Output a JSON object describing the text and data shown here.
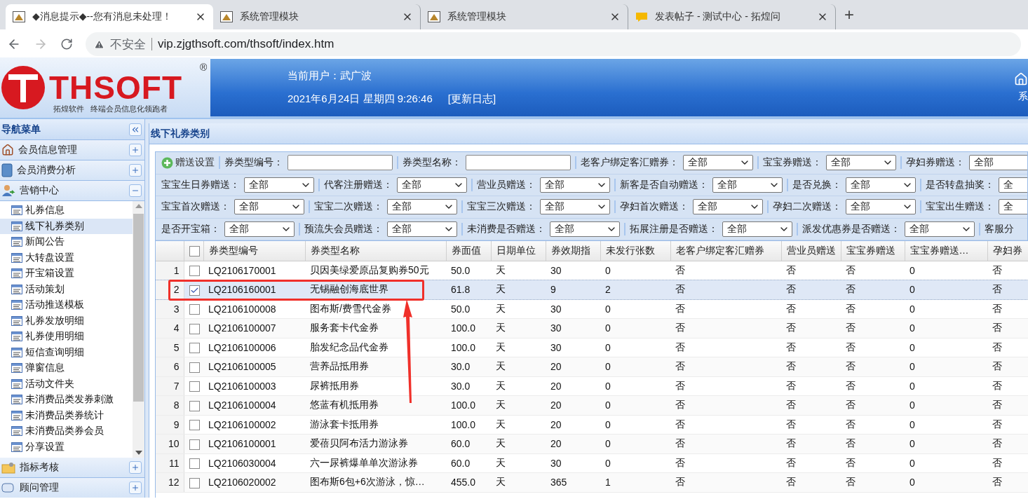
{
  "browser": {
    "tabs": [
      {
        "title": "◆消息提示◆--您有消息未处理！",
        "selected": true,
        "kind": "app"
      },
      {
        "title": "系统管理模块",
        "selected": false,
        "kind": "app"
      },
      {
        "title": "系统管理模块",
        "selected": false,
        "kind": "app"
      },
      {
        "title": "发表帖子 - 测试中心 - 拓煌问",
        "selected": false,
        "kind": "chat"
      }
    ],
    "new_tab": "+",
    "security": "不安全",
    "url": "vip.zjgthsoft.com/thsoft/index.htm"
  },
  "header": {
    "logo": "THSOFT",
    "registered": "®",
    "slogan": "拓煌软件   终端会员信息化领跑者",
    "user_label": "当前用户：",
    "user": "武广波",
    "datetime": "2021年6月24日 星期四 9:26:46",
    "changelog": "[更新日志]",
    "system_button": "系"
  },
  "sidebar": {
    "title": "导航菜单",
    "sections": [
      {
        "label": "会员信息管理",
        "kind": "home",
        "expanded": false
      },
      {
        "label": "会员消费分析",
        "kind": "book",
        "expanded": false
      },
      {
        "label": "营销中心",
        "kind": "person",
        "expanded": true,
        "children": [
          {
            "label": "礼券信息",
            "selected": false
          },
          {
            "label": "线下礼券类别",
            "selected": true
          },
          {
            "label": "新闻公告",
            "selected": false
          },
          {
            "label": "大转盘设置",
            "selected": false
          },
          {
            "label": "开宝箱设置",
            "selected": false
          },
          {
            "label": "活动策划",
            "selected": false
          },
          {
            "label": "活动推送模板",
            "selected": false
          },
          {
            "label": "礼券发放明细",
            "selected": false
          },
          {
            "label": "礼券使用明细",
            "selected": false
          },
          {
            "label": "短信查询明细",
            "selected": false
          },
          {
            "label": "弹窗信息",
            "selected": false
          },
          {
            "label": "活动文件夹",
            "selected": false
          },
          {
            "label": "未消费品类发券刺激",
            "selected": false
          },
          {
            "label": "未消费品类券统计",
            "selected": false
          },
          {
            "label": "未消费品类券会员",
            "selected": false
          },
          {
            "label": "分享设置",
            "selected": false
          }
        ]
      },
      {
        "label": "指标考核",
        "kind": "chart",
        "expanded": false
      },
      {
        "label": "顾问管理",
        "kind": "chat",
        "expanded": false
      }
    ]
  },
  "panel": {
    "title": "线下礼券类别",
    "add_button": "赠送设置",
    "filters": [
      [
        {
          "kind": "text",
          "label": "券类型编号："
        },
        {
          "kind": "text",
          "label": "券类型名称："
        },
        {
          "kind": "select",
          "label": "老客户绑定客汇赠券：",
          "value": "全部"
        },
        {
          "kind": "select",
          "label": "宝宝券赠送：",
          "value": "全部"
        },
        {
          "kind": "edge_select",
          "label": "孕妇券赠送：",
          "value": "全部"
        }
      ],
      [
        {
          "kind": "select",
          "label": "宝宝生日券赠送：",
          "value": "全部"
        },
        {
          "kind": "select",
          "label": "代客注册赠送：",
          "value": "全部"
        },
        {
          "kind": "select",
          "label": "营业员赠送：",
          "value": "全部"
        },
        {
          "kind": "select",
          "label": "新客是否自动赠送：",
          "value": "全部"
        },
        {
          "kind": "select",
          "label": "是否兑换：",
          "value": "全部"
        },
        {
          "kind": "edge_select",
          "label": "是否转盘抽奖：",
          "value": "全"
        }
      ],
      [
        {
          "kind": "select",
          "label": "宝宝首次赠送：",
          "value": "全部"
        },
        {
          "kind": "select",
          "label": "宝宝二次赠送：",
          "value": "全部"
        },
        {
          "kind": "select",
          "label": "宝宝三次赠送：",
          "value": "全部"
        },
        {
          "kind": "select",
          "label": "孕妇首次赠送：",
          "value": "全部"
        },
        {
          "kind": "select",
          "label": "孕妇二次赠送：",
          "value": "全部"
        },
        {
          "kind": "edge_select",
          "label": "宝宝出生赠送：",
          "value": "全"
        }
      ],
      [
        {
          "kind": "select",
          "label": "是否开宝箱：",
          "value": "全部"
        },
        {
          "kind": "select",
          "label": "预流失会员赠送：",
          "value": "全部"
        },
        {
          "kind": "select",
          "label": "未消费是否赠送：",
          "value": "全部"
        },
        {
          "kind": "select",
          "label": "拓展注册是否赠送：",
          "value": "全部"
        },
        {
          "kind": "select",
          "label": "派发优惠券是否赠送：",
          "value": "全部"
        },
        {
          "kind": "label",
          "label": "客服分"
        }
      ]
    ]
  },
  "table": {
    "all_checked": false,
    "columns": [
      "券类型编号",
      "券类型名称",
      "券面值",
      "日期单位",
      "券效期指",
      "未发行张数",
      "老客户绑定客汇赠券",
      "营业员赠送",
      "宝宝券赠送",
      "宝宝券赠送…",
      "孕妇券"
    ],
    "rows": [
      {
        "no": "1",
        "checked": false,
        "selected": false,
        "annotated": false,
        "cells": [
          "LQ2106170001",
          "贝因美绿爱原品复购券50元",
          "50.0",
          "天",
          "30",
          "0",
          "否",
          "否",
          "否",
          "0",
          "否"
        ]
      },
      {
        "no": "2",
        "checked": true,
        "selected": true,
        "annotated": true,
        "cells": [
          "LQ2106160001",
          "无锡融创海底世界",
          "61.8",
          "天",
          "9",
          "2",
          "否",
          "否",
          "否",
          "0",
          "否"
        ]
      },
      {
        "no": "3",
        "checked": false,
        "selected": false,
        "annotated": false,
        "cells": [
          "LQ2106100008",
          "图布斯/费雪代金券",
          "50.0",
          "天",
          "30",
          "0",
          "否",
          "否",
          "否",
          "0",
          "否"
        ]
      },
      {
        "no": "4",
        "checked": false,
        "selected": false,
        "annotated": false,
        "cells": [
          "LQ2106100007",
          "服务套卡代金券",
          "100.0",
          "天",
          "30",
          "0",
          "否",
          "否",
          "否",
          "0",
          "否"
        ]
      },
      {
        "no": "5",
        "checked": false,
        "selected": false,
        "annotated": false,
        "cells": [
          "LQ2106100006",
          "胎发纪念品代金券",
          "100.0",
          "天",
          "30",
          "0",
          "否",
          "否",
          "否",
          "0",
          "否"
        ]
      },
      {
        "no": "6",
        "checked": false,
        "selected": false,
        "annotated": false,
        "cells": [
          "LQ2106100005",
          "营养品抵用券",
          "30.0",
          "天",
          "20",
          "0",
          "否",
          "否",
          "否",
          "0",
          "否"
        ]
      },
      {
        "no": "7",
        "checked": false,
        "selected": false,
        "annotated": false,
        "cells": [
          "LQ2106100003",
          "尿裤抵用券",
          "30.0",
          "天",
          "20",
          "0",
          "否",
          "否",
          "否",
          "0",
          "否"
        ]
      },
      {
        "no": "8",
        "checked": false,
        "selected": false,
        "annotated": false,
        "cells": [
          "LQ2106100004",
          "悠蓝有机抵用券",
          "100.0",
          "天",
          "20",
          "0",
          "否",
          "否",
          "否",
          "0",
          "否"
        ]
      },
      {
        "no": "9",
        "checked": false,
        "selected": false,
        "annotated": false,
        "cells": [
          "LQ2106100002",
          "游泳套卡抵用券",
          "100.0",
          "天",
          "20",
          "0",
          "否",
          "否",
          "否",
          "0",
          "否"
        ]
      },
      {
        "no": "10",
        "checked": false,
        "selected": false,
        "annotated": false,
        "cells": [
          "LQ2106100001",
          "爱蓓贝阿布活力游泳券",
          "60.0",
          "天",
          "20",
          "0",
          "否",
          "否",
          "否",
          "0",
          "否"
        ]
      },
      {
        "no": "11",
        "checked": false,
        "selected": false,
        "annotated": false,
        "cells": [
          "LQ2106030004",
          "六一尿裤爆单单次游泳券",
          "60.0",
          "天",
          "30",
          "0",
          "否",
          "否",
          "否",
          "0",
          "否"
        ]
      },
      {
        "no": "12",
        "checked": false,
        "selected": false,
        "annotated": false,
        "cells": [
          "LQ2106020002",
          "图布斯6包+6次游泳，惊…",
          "455.0",
          "天",
          "365",
          "1",
          "否",
          "否",
          "否",
          "0",
          "否"
        ]
      }
    ]
  }
}
